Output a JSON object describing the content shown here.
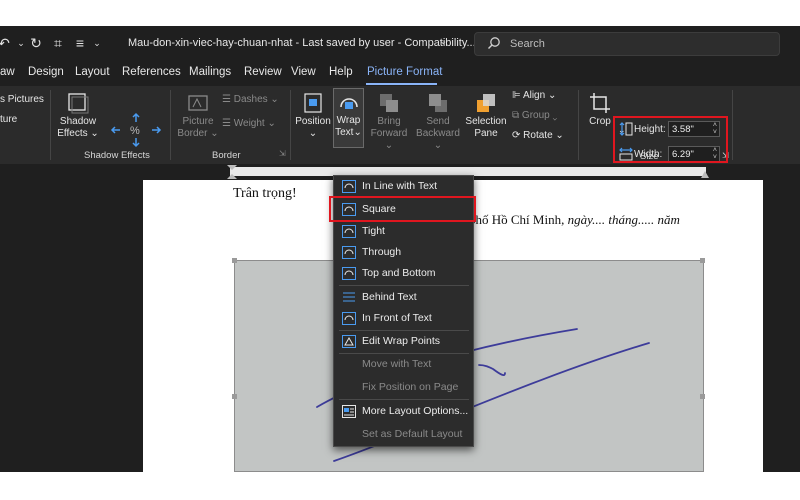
{
  "titlebar": {
    "doc_title": "Mau-don-xin-viec-hay-chuan-nhat - Last saved by user - Compatibility...",
    "search_placeholder": "Search"
  },
  "tabs": [
    "aw",
    "Design",
    "Layout",
    "References",
    "Mailings",
    "Review",
    "View",
    "Help",
    "Picture Format"
  ],
  "ribbon": {
    "pictures_label": "s Pictures",
    "ture_label": "ture",
    "shadow_effects": [
      "Shadow",
      "Effects"
    ],
    "shadow_group": "Shadow Effects",
    "picture_border": [
      "Picture",
      "Border"
    ],
    "dashes": "Dashes",
    "weight": "Weight",
    "border_group": "Border",
    "position": "Position",
    "wrap_text": [
      "Wrap",
      "Text"
    ],
    "bring_forward": [
      "Bring",
      "Forward"
    ],
    "send_backward": [
      "Send",
      "Backward"
    ],
    "selection_pane": [
      "Selection",
      "Pane"
    ],
    "align": "Align",
    "group": "Group",
    "rotate": "Rotate",
    "crop": "Crop",
    "height_label": "Height:",
    "height_value": "3.58\"",
    "width_label": "Width:",
    "width_value": "6.29\"",
    "size_group": "Size",
    "highlight_color": "#e0161f"
  },
  "document": {
    "greeting": "Trân trọng!",
    "city_prefix": "phố Hồ Chí Minh, ",
    "city_date": "ngày.... tháng..... năm"
  },
  "wrap_menu": [
    {
      "label": "In Line with Text",
      "icon": "inline-icon",
      "enabled": true
    },
    {
      "label": "Square",
      "icon": "square-icon",
      "enabled": true,
      "highlighted": true
    },
    {
      "label": "Tight",
      "icon": "tight-icon",
      "enabled": true
    },
    {
      "label": "Through",
      "icon": "through-icon",
      "enabled": true
    },
    {
      "label": "Top and Bottom",
      "icon": "top-bottom-icon",
      "enabled": true
    },
    {
      "label": "Behind Text",
      "icon": "behind-text-icon",
      "enabled": true
    },
    {
      "label": "In Front of Text",
      "icon": "in-front-icon",
      "enabled": true
    },
    {
      "label": "Edit Wrap Points",
      "icon": "edit-points-icon",
      "enabled": true
    },
    {
      "label": "Move with Text",
      "icon": "",
      "enabled": false
    },
    {
      "label": "Fix Position on Page",
      "icon": "",
      "enabled": false
    },
    {
      "label": "More Layout Options...",
      "icon": "layout-options-icon",
      "enabled": true
    },
    {
      "label": "Set as Default Layout",
      "icon": "",
      "enabled": false
    }
  ]
}
